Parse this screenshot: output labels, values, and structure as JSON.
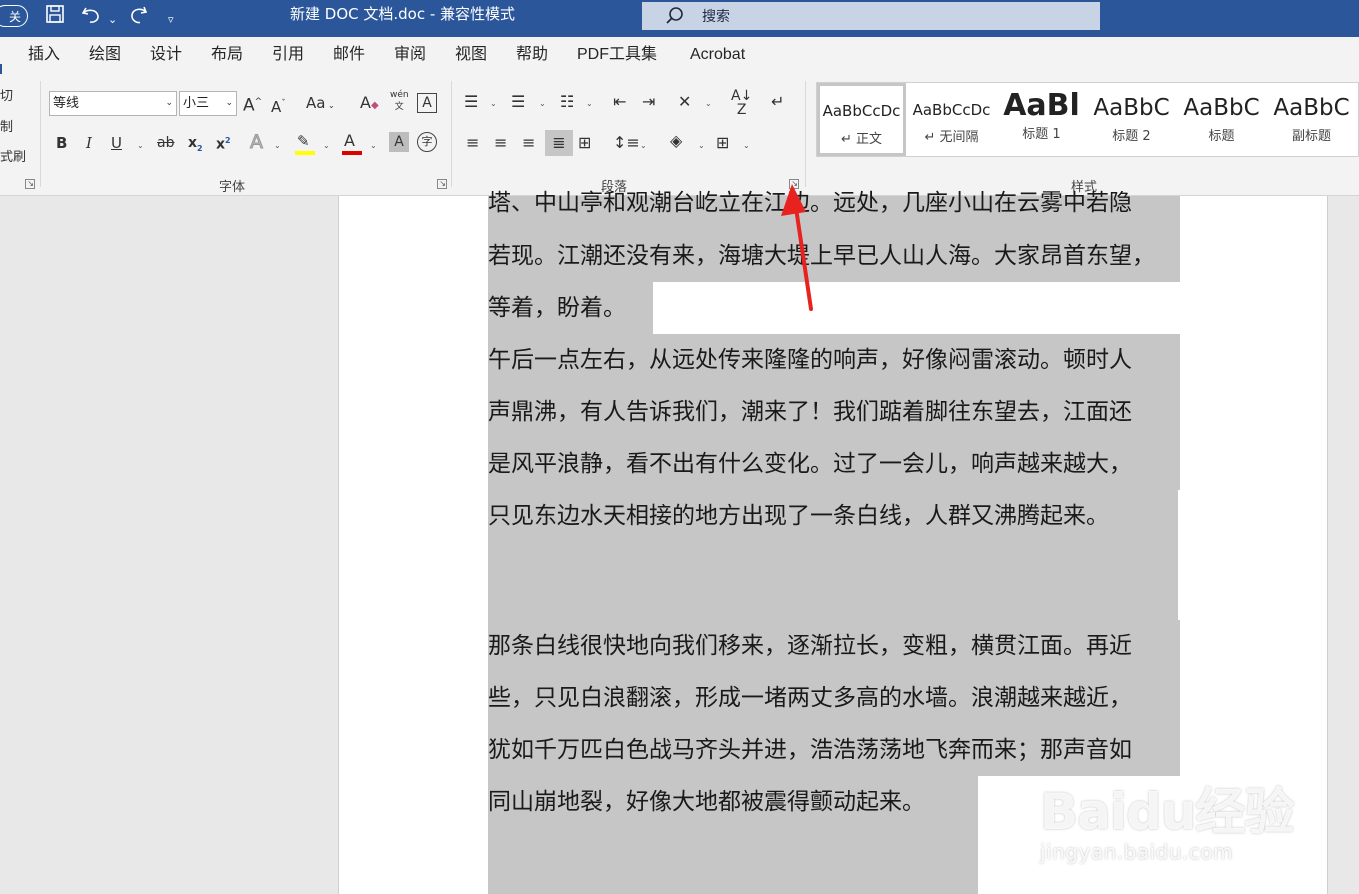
{
  "titlebar": {
    "autosave_toggle": "关",
    "document_title": "新建 DOC 文档.doc  -  兼容性模式",
    "search_placeholder": "搜索"
  },
  "tabs": [
    "插入",
    "绘图",
    "设计",
    "布局",
    "引用",
    "邮件",
    "审阅",
    "视图",
    "帮助",
    "PDF工具集",
    "Acrobat"
  ],
  "ribbon": {
    "clipboard_fragments": [
      "切",
      "制",
      "式刷"
    ],
    "font": {
      "label": "字体",
      "font_name": "等线",
      "font_size": "小三",
      "grow": "A",
      "shrink": "A",
      "change_case": "Aa",
      "phonetic": "wén",
      "bold": "B",
      "italic": "I",
      "underline": "U",
      "strike": "ab",
      "subscript": "x",
      "superscript": "x",
      "effects": "A",
      "highlight_color": "#ffff00",
      "font_color": "#e00000",
      "font_color_letter": "A",
      "shading": "A",
      "enclose": "字"
    },
    "paragraph": {
      "label": "段落"
    },
    "styles": {
      "label": "样式",
      "items": [
        {
          "preview": "AaBbCcDc",
          "name": "↵ 正文",
          "selected": true
        },
        {
          "preview": "AaBbCcDc",
          "name": "↵ 无间隔",
          "selected": false
        },
        {
          "preview": "AaBl",
          "name": "标题 1",
          "selected": false
        },
        {
          "preview": "AaBbC",
          "name": "标题 2",
          "selected": false
        },
        {
          "preview": "AaBbC",
          "name": "标题",
          "selected": false
        },
        {
          "preview": "AaBbC",
          "name": "副标题",
          "selected": false
        }
      ]
    }
  },
  "document": {
    "lines": [
      "塔、中山亭和观潮台屹立在江边。远处，几座小山在云雾中若隐",
      "若现。江潮还没有来，海塘大堤上早已人山人海。大家昂首东望，",
      "等着，盼着。",
      "午后一点左右，从远处传来隆隆的响声，好像闷雷滚动。顿时人",
      "声鼎沸，有人告诉我们，潮来了！我们踮着脚往东望去，江面还",
      "是风平浪静，看不出有什么变化。过了一会儿，响声越来越大，",
      "只见东边水天相接的地方出现了一条白线，人群又沸腾起来。",
      "那条白线很快地向我们移来，逐渐拉长，变粗，横贯江面。再近",
      "些，只见白浪翻滚，形成一堵两丈多高的水墙。浪潮越来越近，",
      "犹如千万匹白色战马齐头并进，浩浩荡荡地飞奔而来；那声音如",
      "同山崩地裂，好像大地都被震得颤动起来。"
    ]
  },
  "watermark": {
    "logo": "Baidu经验",
    "url": "jingyan.baidu.com"
  },
  "colors": {
    "titlebar": "#2b579a",
    "ribbon": "#f3f3f3",
    "selection": "#c6c6c6",
    "annotation_arrow": "#e8231f"
  }
}
